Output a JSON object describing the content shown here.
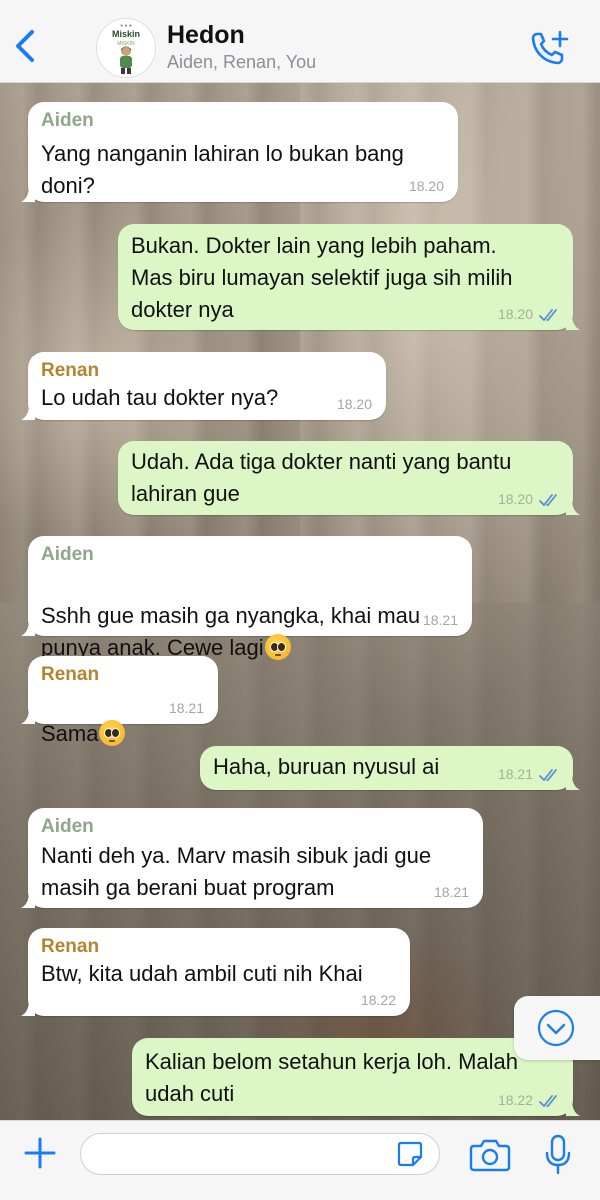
{
  "header": {
    "title": "Hedon",
    "subtitle": "Aiden, Renan, You",
    "avatar_text": "Miskin",
    "avatar_small_text": "MISKIN"
  },
  "messages": [
    {
      "direction": "in",
      "sender": "Aiden",
      "text": "Yang nanganin lahiran lo bukan bang\ndoni?",
      "time": "18.20"
    },
    {
      "direction": "out",
      "text": "Bukan. Dokter lain yang lebih paham.\nMas biru lumayan selektif juga sih milih\ndokter nya",
      "time": "18.20",
      "read": true
    },
    {
      "direction": "in",
      "sender": "Renan",
      "text": "Lo udah tau dokter nya?",
      "time": "18.20"
    },
    {
      "direction": "out",
      "text": "Udah. Ada tiga dokter nanti yang bantu\nlahiran gue",
      "time": "18.20",
      "read": true
    },
    {
      "direction": "in",
      "sender": "Aiden",
      "text": "Sshh gue masih ga nyangka, khai mau\npunya anak. Cewe lagi",
      "emoji": "pleading-face",
      "time": "18.21"
    },
    {
      "direction": "in",
      "sender": "Renan",
      "text": "Sama",
      "emoji": "pleading-face",
      "time": "18.21"
    },
    {
      "direction": "out",
      "text": "Haha, buruan nyusul ai",
      "time": "18.21",
      "read": true
    },
    {
      "direction": "in",
      "sender": "Aiden",
      "text": "Nanti deh ya. Marv masih sibuk jadi gue\nmasih ga berani buat program",
      "time": "18.21"
    },
    {
      "direction": "in",
      "sender": "Renan",
      "text": "Btw, kita udah ambil cuti nih Khai",
      "time": "18.22"
    },
    {
      "direction": "out",
      "text": "Kalian belom setahun kerja loh. Malah\nudah cuti",
      "time": "18.22",
      "read": true
    }
  ],
  "input": {
    "placeholder": "",
    "value": ""
  },
  "icons": {
    "back": "chevron-left-icon",
    "call": "phone-plus-icon",
    "scroll": "chevron-down-circle-icon",
    "add": "plus-icon",
    "sticker": "sticker-icon",
    "camera": "camera-icon",
    "mic": "microphone-icon",
    "read": "double-check-icon"
  },
  "colors": {
    "accent": "#1a7cf5",
    "incoming_bubble": "#ffffff",
    "outgoing_bubble": "#dcf7c5",
    "sender_aiden": "#8fa68a",
    "sender_renan": "#b58430",
    "read_ticks": "#5b8ed6"
  }
}
